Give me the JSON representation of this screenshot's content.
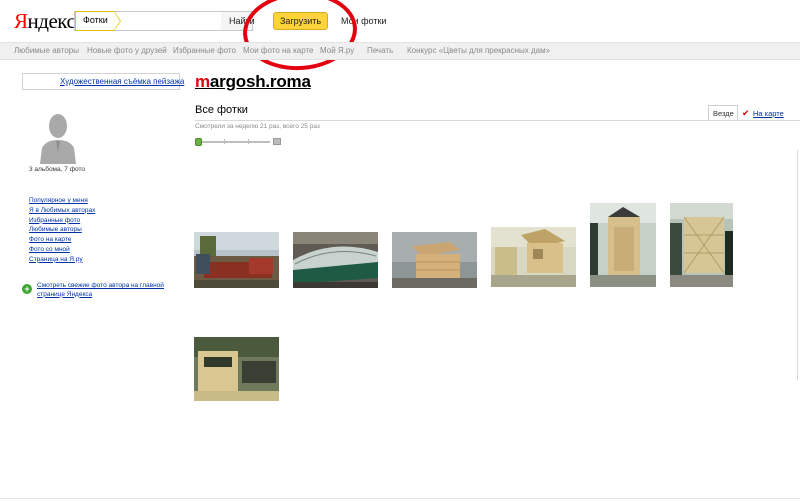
{
  "header": {
    "logo_ya": "Я",
    "logo_rest": "ндекс",
    "search_scope": "Фотки",
    "search_value": "",
    "search_button": "Найти",
    "upload_button": "Загрузить",
    "my_photos": "Мои фотки"
  },
  "nav": {
    "items": [
      "Любимые авторы",
      "Новые фото у друзей",
      "Избранные фото",
      "Мои фото на карте",
      "Мой Я.ру",
      "Печать",
      "Конкурс «Цветы для прекрасных дам»"
    ]
  },
  "sidebar": {
    "album_link": "Художественная съёмка пейзажа",
    "counts": "3 альбома, 7 фото",
    "links": [
      "Популярное у меня",
      "Я в Любимых авторах",
      "Избранные фото",
      "Любимые авторы",
      "Фото на карте",
      "Фото со мной",
      "Страница на Я.ру"
    ],
    "see_own": "Смотреть свежие фото автора на главной странице Яндекса"
  },
  "main": {
    "username_first": "m",
    "username_rest": "argosh.roma",
    "title": "Все фотки",
    "views": "Смотрели за неделю 21 раз, всего 25 раз",
    "tab_all": "Везде",
    "tab_map": "На карте"
  },
  "colors": {
    "accent_yellow": "#fcd33b",
    "annotation_red": "#e3000f",
    "link_blue": "#0033aa"
  },
  "photos": [
    {
      "name": "photo-brick-garden"
    },
    {
      "name": "photo-greenhouse"
    },
    {
      "name": "photo-wooden-box"
    },
    {
      "name": "photo-playhouse"
    },
    {
      "name": "photo-outhouse"
    },
    {
      "name": "photo-pergola"
    },
    {
      "name": "photo-bench"
    }
  ]
}
